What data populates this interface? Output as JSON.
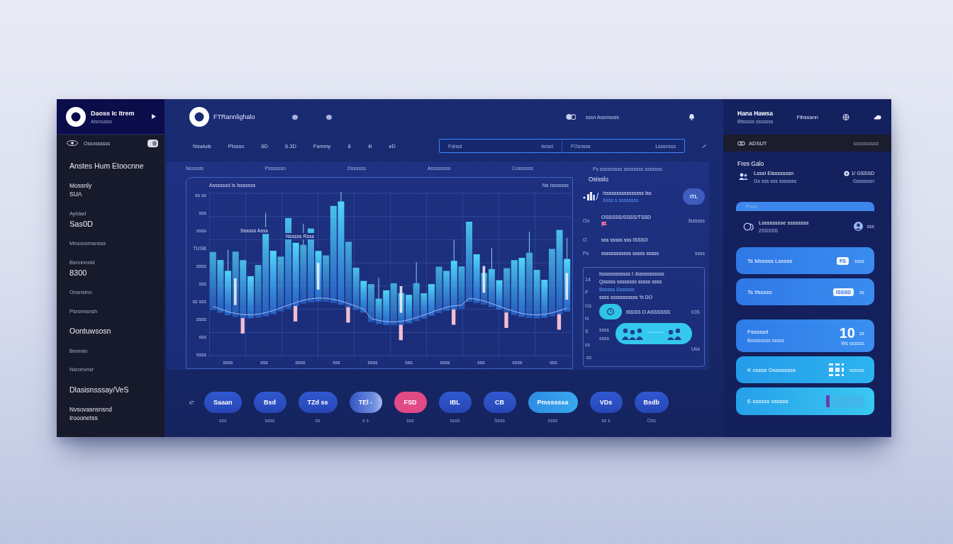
{
  "sidebar": {
    "brand": {
      "name": "Daoss Ic Itrem",
      "subtitle": "Atsnsaiss"
    },
    "account": {
      "label": "Ossossssss",
      "on": true
    },
    "items": [
      {
        "kind": "heading",
        "label": "Anstes Hum Etoocnne"
      },
      {
        "kind": "stacked",
        "label": "Mossnly",
        "value": "SUA"
      },
      {
        "kind": "metric",
        "label": "Aytdad",
        "value": "Sas0D"
      },
      {
        "kind": "link",
        "label": "Mnsovsmsnsss"
      },
      {
        "kind": "metric",
        "label": "Bsnnnnnld",
        "value": "8300"
      },
      {
        "kind": "link",
        "label": "Onsnsino"
      },
      {
        "kind": "link",
        "label": "Psrsnnsnsh"
      },
      {
        "kind": "heading",
        "label": "Oontuwsosn"
      },
      {
        "kind": "link",
        "label": "Bmnnlo"
      },
      {
        "kind": "link",
        "label": "Nsronvnsr"
      },
      {
        "kind": "heading",
        "label": "Dlasisnsssay/VeS"
      },
      {
        "kind": "stacked",
        "label": "Nvsovasnsnsnd",
        "value": "Irooonetss"
      }
    ]
  },
  "header": {
    "brand": "FTRannlighalo",
    "user": "sssn Assnsssis"
  },
  "toolbar": {
    "items": [
      "Nswiuls",
      "Ptsssn",
      "8D",
      "6.3D",
      "Fsmmy",
      "8",
      "4l",
      "eD"
    ],
    "range": {
      "start_label": "Fdnsd",
      "start_value": "Isnsd",
      "end_label": "FOsnsse",
      "end_value": "Lsssnsss"
    }
  },
  "panel": {
    "labels": [
      "Nosossi",
      "Pssssssn",
      "Dssssss",
      "Assssssss",
      "Cossssss"
    ],
    "chart": {
      "title": "Assssssd Is Isssssss",
      "corner_label": "Ns Isssssss",
      "annotations": [
        "Ssssss Asss",
        "Nsssss Rsss"
      ],
      "y_labels": [
        "ss ss",
        "sss",
        "ssss",
        "TUSB",
        "ssss",
        "sss",
        "ss sss",
        "ssss",
        "sss",
        "ssss"
      ],
      "x_labels": [
        "ssss",
        "sss",
        "ssss",
        "sss",
        "ssss",
        "sss",
        "ssss",
        "sss",
        "ssss",
        "sss"
      ]
    },
    "insights": {
      "caption": "Ps sssssssss ssssssss sssssss",
      "heading": "Osisslo",
      "rows": [
        {
          "kind": "metric",
          "title": "/ssssssssssssssss Iss",
          "sub": "Ssss s ssssssss",
          "action": "ITL"
        },
        {
          "kind": "alert",
          "marker": "Oo",
          "title": "OSSSSS/SSSS/TSSD",
          "trail": "Jssssss"
        },
        {
          "kind": "entry",
          "marker": "O",
          "title": "sss sssss sss ISSSO"
        },
        {
          "kind": "entry",
          "marker": "Ps",
          "title": "ssssssssssss sssss sssss",
          "trail": "ssss"
        }
      ],
      "box": {
        "markers": [
          "14",
          "P",
          "Gs",
          "N",
          "S",
          "ss",
          "-ss"
        ],
        "lines": [
          {
            "kind": "text",
            "text": "Issssssssssss I Jsssssssssss"
          },
          {
            "kind": "text",
            "text": "Qsssss ssssssss sssss ssss"
          },
          {
            "kind": "link",
            "text": "Bsssss Sssssss"
          },
          {
            "kind": "text",
            "text": "ssss sssssssssss % DO"
          }
        ],
        "action": {
          "label": "ISSSS O ASSSSSS",
          "value": "IOS"
        },
        "banner_labels": [
          "ssss",
          "ssss"
        ],
        "footer": "Uss"
      }
    }
  },
  "actions": [
    {
      "label": "Saaan",
      "caption": "sss",
      "kind": "default"
    },
    {
      "label": "Bsd",
      "caption": "ssss",
      "kind": "default"
    },
    {
      "label": "TZd ss",
      "caption": "ss",
      "kind": "default"
    },
    {
      "label": "TEl -",
      "caption": "s s",
      "kind": "soft"
    },
    {
      "label": "FSD",
      "caption": "sss",
      "kind": "alert"
    },
    {
      "label": "IBL",
      "caption": "ssss",
      "kind": "default"
    },
    {
      "label": "CB",
      "caption": "Ssss",
      "kind": "default"
    },
    {
      "label": "Pmsssssa",
      "caption": "ssss",
      "kind": "info"
    },
    {
      "label": "VDs",
      "caption": "ss s",
      "kind": "default"
    },
    {
      "label": "Bsdb",
      "caption": "Oss",
      "kind": "default"
    }
  ],
  "profile": {
    "name": "Hana Hawsa",
    "subtitle": "Bfsssss sssssss",
    "link": "Fibssann",
    "band": {
      "label": "ADSUT",
      "meta": "sssssssssd"
    },
    "section_title": "Fres Galo",
    "entry": {
      "title": "Lsssl Eisssssssn",
      "sub": "Gs sss sss sssssss",
      "meta": "1/ GSSSD",
      "meta_sub": "Gssssssn"
    },
    "strip_label": "Psss",
    "entry_2": {
      "title": "Lsssssssse ssssssss",
      "sub": "2SSSSS",
      "note": "sss"
    },
    "cards": [
      {
        "kind": "badge",
        "title": "Ts Msssss Lsssss",
        "badge": "FS",
        "trail": "ssss"
      },
      {
        "kind": "badge",
        "title": "Ts Ifsssss",
        "badge": "ISSSD",
        "trail": "ss"
      },
      {
        "kind": "stat",
        "title": "Fsssssd",
        "sub": "Bssssssss sssss",
        "value": "10",
        "unit": "ss",
        "value_sub": "Ws ssssss"
      },
      {
        "kind": "qr",
        "title": "K cssss Gssssssss",
        "trail": "ssssss"
      },
      {
        "kind": "image",
        "title": "E ssssss ssssss"
      }
    ]
  }
}
